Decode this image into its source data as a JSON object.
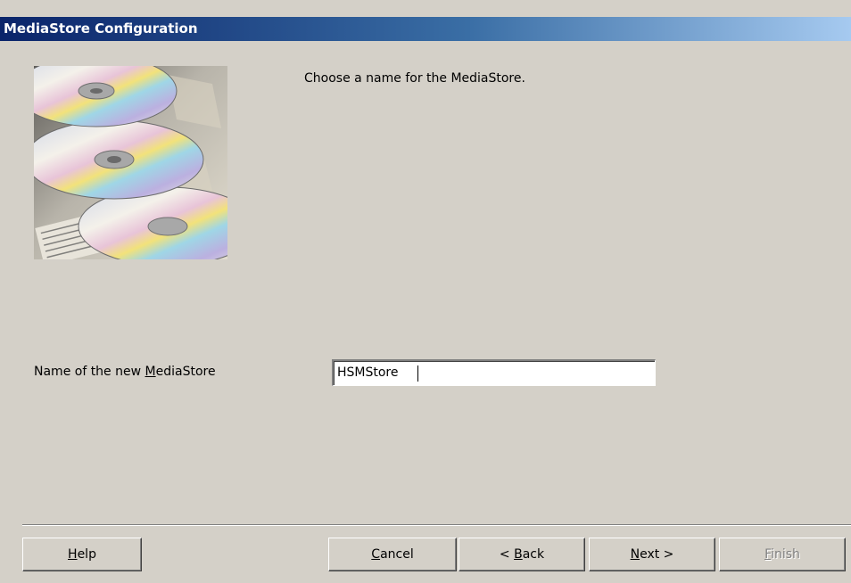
{
  "window": {
    "title": "MediaStore Configuration"
  },
  "header": {
    "prompt": "Choose a name for the MediaStore."
  },
  "field": {
    "label_pre": "Name of the new ",
    "label_accel": "M",
    "label_post": "ediaStore",
    "value": "HSMStore"
  },
  "buttons": {
    "help": {
      "accel": "H",
      "rest": "elp"
    },
    "cancel": {
      "accel": "C",
      "rest": "ancel"
    },
    "back": {
      "pre": "< ",
      "accel": "B",
      "rest": "ack"
    },
    "next": {
      "accel": "N",
      "rest": "ext >"
    },
    "finish": {
      "accel": "F",
      "rest": "inish",
      "enabled": false
    }
  },
  "image": {
    "icon": "cd-discs-image"
  }
}
